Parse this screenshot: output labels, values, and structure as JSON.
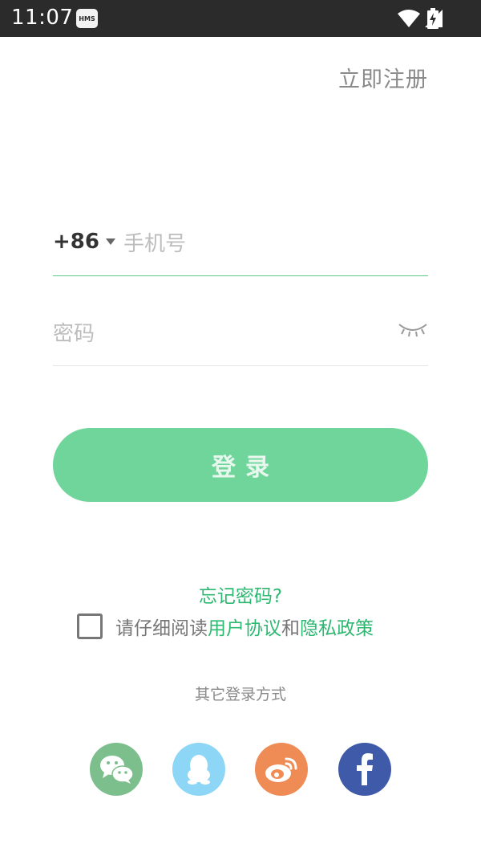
{
  "status_bar": {
    "time": "11:07",
    "hms_badge": "HMS"
  },
  "header": {
    "register_label": "立即注册"
  },
  "form": {
    "country_code": "+86",
    "phone_placeholder": "手机号",
    "password_placeholder": "密码",
    "login_label": "登录"
  },
  "links": {
    "forgot_password": "忘记密码?"
  },
  "agreement": {
    "prefix": "请仔细阅读",
    "user_agreement": "用户协议",
    "and": "和",
    "privacy_policy": "隐私政策",
    "checked": false
  },
  "other_login": {
    "title": "其它登录方式",
    "providers": [
      "wechat-icon",
      "qq-icon",
      "weibo-icon",
      "facebook-icon"
    ]
  },
  "colors": {
    "accent": "#2eb872",
    "button": "#6fd59a",
    "status_bar": "#2b2b2b"
  }
}
